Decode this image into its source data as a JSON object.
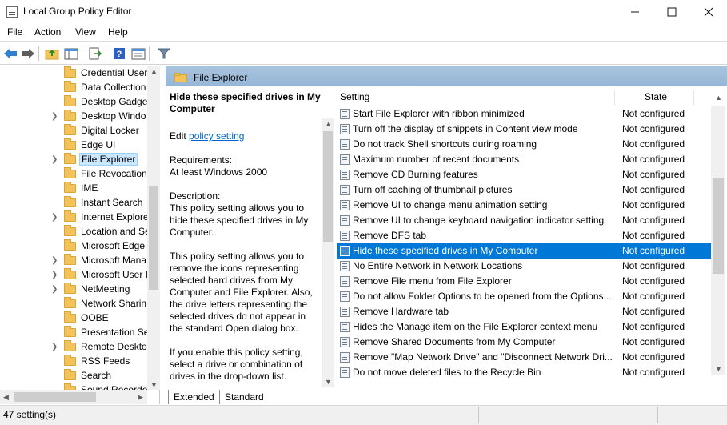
{
  "window": {
    "title": "Local Group Policy Editor"
  },
  "menu": [
    "File",
    "Action",
    "View",
    "Help"
  ],
  "tree": {
    "items": [
      {
        "label": "Credential User",
        "expandable": false
      },
      {
        "label": "Data Collection",
        "expandable": false
      },
      {
        "label": "Desktop Gadget",
        "expandable": false
      },
      {
        "label": "Desktop Windo",
        "expandable": true
      },
      {
        "label": "Digital Locker",
        "expandable": false
      },
      {
        "label": "Edge UI",
        "expandable": false
      },
      {
        "label": "File Explorer",
        "expandable": true,
        "selected": true
      },
      {
        "label": "File Revocation",
        "expandable": false
      },
      {
        "label": "IME",
        "expandable": false
      },
      {
        "label": "Instant Search",
        "expandable": false
      },
      {
        "label": "Internet Explore",
        "expandable": true
      },
      {
        "label": "Location and Se",
        "expandable": false
      },
      {
        "label": "Microsoft Edge",
        "expandable": false
      },
      {
        "label": "Microsoft Mana",
        "expandable": true
      },
      {
        "label": "Microsoft User I",
        "expandable": true
      },
      {
        "label": "NetMeeting",
        "expandable": true
      },
      {
        "label": "Network Sharin",
        "expandable": false
      },
      {
        "label": "OOBE",
        "expandable": false
      },
      {
        "label": "Presentation Se",
        "expandable": false
      },
      {
        "label": "Remote Desktop",
        "expandable": true
      },
      {
        "label": "RSS Feeds",
        "expandable": false
      },
      {
        "label": "Search",
        "expandable": false
      },
      {
        "label": "Sound Recorder",
        "expandable": false
      }
    ]
  },
  "right_header": {
    "title": "File Explorer"
  },
  "description": {
    "title": "Hide these specified drives in My Computer",
    "edit_prefix": "Edit",
    "edit_link": "policy setting",
    "requirements_label": "Requirements:",
    "requirements_value": "At least Windows 2000",
    "description_label": "Description:",
    "para1": "This policy setting allows you to hide these specified drives in My Computer.",
    "para2": "This policy setting allows you to remove the icons representing selected hard drives from My Computer and File Explorer. Also, the drive letters representing the selected drives do not appear in the standard Open dialog box.",
    "para3": "If you enable this policy setting, select a drive or combination of drives in the drop-down list."
  },
  "list": {
    "columns": {
      "setting": "Setting",
      "state": "State"
    },
    "rows": [
      {
        "setting": "Start File Explorer with ribbon minimized",
        "state": "Not configured"
      },
      {
        "setting": "Turn off the display of snippets in Content view mode",
        "state": "Not configured"
      },
      {
        "setting": "Do not track Shell shortcuts during roaming",
        "state": "Not configured"
      },
      {
        "setting": "Maximum number of recent documents",
        "state": "Not configured"
      },
      {
        "setting": "Remove CD Burning features",
        "state": "Not configured"
      },
      {
        "setting": "Turn off caching of thumbnail pictures",
        "state": "Not configured"
      },
      {
        "setting": "Remove UI to change menu animation setting",
        "state": "Not configured"
      },
      {
        "setting": "Remove UI to change keyboard navigation indicator setting",
        "state": "Not configured"
      },
      {
        "setting": "Remove DFS tab",
        "state": "Not configured"
      },
      {
        "setting": "Hide these specified drives in My Computer",
        "state": "Not configured",
        "selected": true
      },
      {
        "setting": "No Entire Network in Network Locations",
        "state": "Not configured"
      },
      {
        "setting": "Remove File menu from File Explorer",
        "state": "Not configured"
      },
      {
        "setting": "Do not allow Folder Options to be opened from the Options...",
        "state": "Not configured"
      },
      {
        "setting": "Remove Hardware tab",
        "state": "Not configured"
      },
      {
        "setting": "Hides the Manage item on the File Explorer context menu",
        "state": "Not configured"
      },
      {
        "setting": "Remove Shared Documents from My Computer",
        "state": "Not configured"
      },
      {
        "setting": "Remove \"Map Network Drive\" and \"Disconnect Network Dri...",
        "state": "Not configured"
      },
      {
        "setting": "Do not move deleted files to the Recycle Bin",
        "state": "Not configured"
      }
    ]
  },
  "tabs": [
    "Extended",
    "Standard"
  ],
  "status": {
    "text": "47 setting(s)"
  },
  "colors": {
    "selection": "#0078d7",
    "header": "#a9c4de",
    "folder": "#f3c35a",
    "link": "#0066cc"
  }
}
